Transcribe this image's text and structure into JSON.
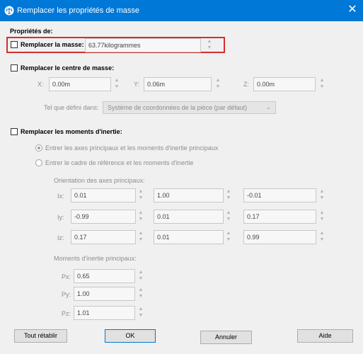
{
  "window": {
    "title": "Remplacer les propriétés de masse",
    "close_glyph": "✕",
    "accent": "#0078d7"
  },
  "properties_label": "Propriétés de:",
  "mass": {
    "checkbox_label": "Remplacer la masse:",
    "value": "63.77kilogrammes"
  },
  "center": {
    "checkbox_label": "Remplacer le centre de masse:",
    "x_label": "X:",
    "x_value": "0.00m",
    "y_label": "Y:",
    "y_value": "0.06m",
    "z_label": "Z:",
    "z_value": "0.00m",
    "defined_label": "Tel que défini dans:",
    "coord_system": "Système de coordonnées de la pièce (par défaut)"
  },
  "inertia": {
    "checkbox_label": "Remplacer les moments d'inertie:",
    "radio_principal": "Entrer les axes principaux et les moments d'inertie principaux",
    "radio_reference": "Entrer le cadre de référence et les moments d'inertie",
    "orientation_label": "Orientation des axes principaux:",
    "rows": [
      {
        "label": "Ix:",
        "values": [
          "0.01",
          "1.00",
          "-0.01"
        ]
      },
      {
        "label": "Iy:",
        "values": [
          "-0.99",
          "0.01",
          "0.17"
        ]
      },
      {
        "label": "Iz:",
        "values": [
          "0.17",
          "0.01",
          "0.99"
        ]
      }
    ],
    "moments_label": "Moments d'inertie principaux:",
    "moments": [
      {
        "label": "Px:",
        "value": "0.65"
      },
      {
        "label": "Py:",
        "value": "1.00"
      },
      {
        "label": "Pz:",
        "value": "1.01"
      }
    ]
  },
  "buttons": {
    "reset": "Tout rétablir",
    "ok": "OK",
    "cancel": "Annuler",
    "help": "Aide"
  }
}
